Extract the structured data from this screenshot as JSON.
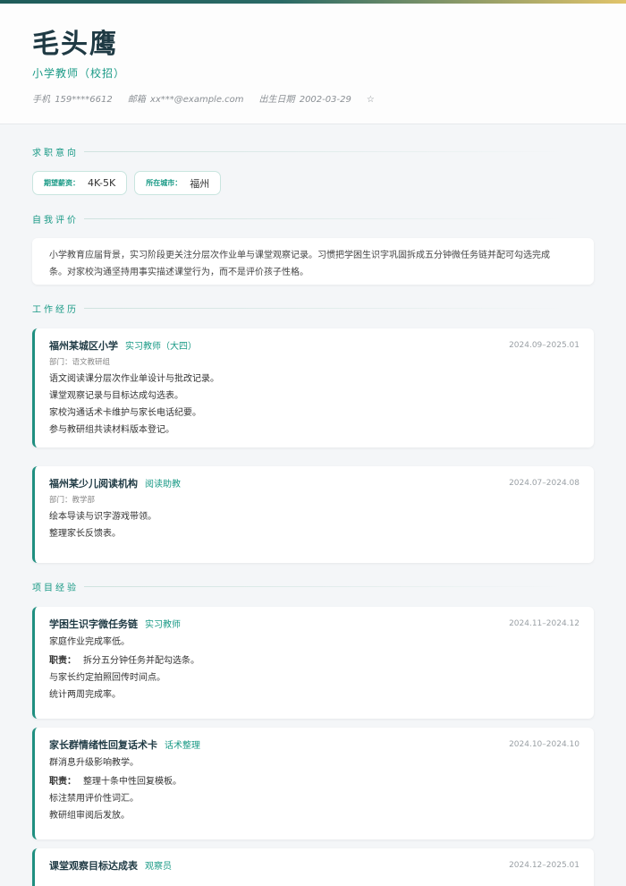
{
  "header": {
    "name": "毛头鹰",
    "title": "小学教师（校招）",
    "phone_label": "手机",
    "phone": "159****6612",
    "email_label": "邮箱",
    "email": "xx***@example.com",
    "birth_label": "出生日期",
    "birth": "2002-03-29",
    "star": "☆"
  },
  "sections": {
    "intent": "求职意向",
    "self": "自我评价",
    "work": "工作经历",
    "projects": "项目经验"
  },
  "intent": {
    "salary_label": "期望薪资：",
    "salary": "4K-5K",
    "city_label": "所在城市：",
    "city": "福州"
  },
  "self_eval": {
    "line1": "小学教育应届背景，实习阶段更关注分层次作业单与课堂观察记录。习惯把学困生识字巩固拆成五分钟微任务链并配可勾选完成",
    "line2": "条。对家校沟通坚持用事实描述课堂行为，而不是评价孩子性格。"
  },
  "work": [
    {
      "company": "福州某城区小学",
      "role": "实习教师（大四）",
      "date": "2024.09–2025.01",
      "dept": "部门：语文教研组",
      "lines": [
        "语文阅读课分层次作业单设计与批改记录。",
        "课堂观察记录与目标达成勾选表。",
        "家校沟通话术卡维护与家长电话纪要。",
        "参与教研组共读材料版本登记。"
      ]
    },
    {
      "company": "福州某少儿阅读机构",
      "role": "阅读助教",
      "date": "2024.07–2024.08",
      "dept": "部门：教学部",
      "lines": [
        "绘本导读与识字游戏带领。",
        "整理家长反馈表。"
      ]
    }
  ],
  "projects": [
    {
      "name": "学困生识字微任务链",
      "role": "实习教师",
      "date": "2024.11–2024.12",
      "desc": "家庭作业完成率低。",
      "duty_label": "职责：",
      "duty": "拆分五分钟任务并配勾选条。",
      "lines": [
        "与家长约定拍照回传时间点。",
        "统计两周完成率。"
      ]
    },
    {
      "name": "家长群情绪性回复话术卡",
      "role": "话术整理",
      "date": "2024.10–2024.10",
      "desc": "群消息升级影响教学。",
      "duty_label": "职责：",
      "duty": "整理十条中性回复模板。",
      "lines": [
        "标注禁用评价性词汇。",
        "教研组审阅后发放。"
      ]
    },
    {
      "name": "课堂观察目标达成表",
      "role": "观察员",
      "date": "2024.12–2025.01"
    }
  ]
}
